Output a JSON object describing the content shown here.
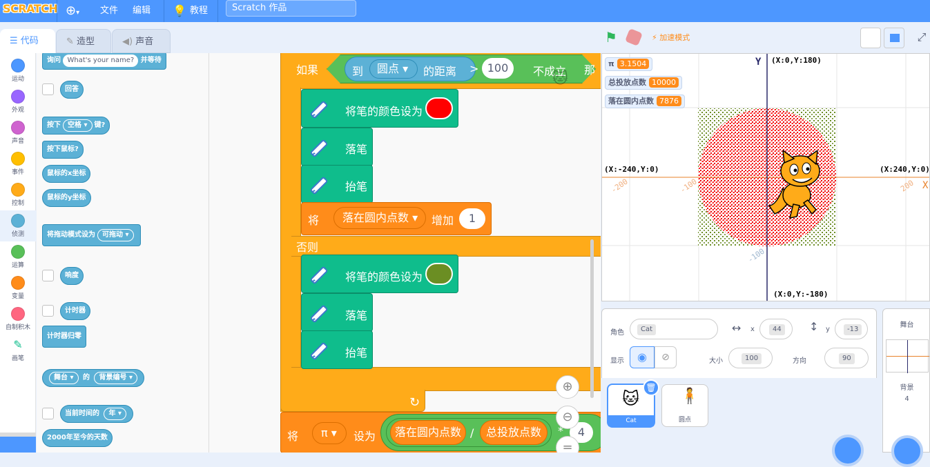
{
  "menubar": {
    "logo": "SCRATCH",
    "file": "文件",
    "edit": "编辑",
    "tutorials": "教程",
    "project_title": "Scratch 作品"
  },
  "tabs": {
    "code": "代码",
    "costumes": "造型",
    "sounds": "声音"
  },
  "categories": [
    {
      "label": "运动",
      "color": "#4c97ff"
    },
    {
      "label": "外观",
      "color": "#9966ff"
    },
    {
      "label": "声音",
      "color": "#cf63cf"
    },
    {
      "label": "事件",
      "color": "#ffbf00"
    },
    {
      "label": "控制",
      "color": "#ffab19"
    },
    {
      "label": "侦测",
      "color": "#5cb1d6"
    },
    {
      "label": "运算",
      "color": "#59c059"
    },
    {
      "label": "变量",
      "color": "#ff8c1a"
    },
    {
      "label": "自制积木",
      "color": "#ff6680"
    },
    {
      "label": "画笔",
      "color": "#0fbd8c"
    }
  ],
  "palette": {
    "ask_prefix": "询问",
    "ask_default": "What's your name?",
    "ask_suffix": "并等待",
    "answer": "回答",
    "key_pressed_prefix": "按下",
    "key_space": "空格",
    "key_pressed_suffix": "键?",
    "mouse_down": "按下鼠标?",
    "mouse_x": "鼠标的x坐标",
    "mouse_y": "鼠标的y坐标",
    "drag_mode_prefix": "将拖动模式设为",
    "drag_mode_value": "可拖动",
    "loudness": "响度",
    "timer": "计时器",
    "reset_timer": "计时器归零",
    "of_stage": "舞台",
    "of_word": "的",
    "of_backdrop": "背景编号",
    "current_prefix": "当前时间的",
    "current_year": "年",
    "days_since": "2000年至今的天数"
  },
  "script": {
    "if_label": "如果",
    "to_label": "到",
    "target": "圆点",
    "distance_label": "的距离",
    "gt": ">",
    "compare_value": "100",
    "not_true": "不成立",
    "then": "那",
    "set_pen_color": "将笔的颜色设为",
    "pen_down": "落笔",
    "pen_up": "抬笔",
    "change_prefix": "将",
    "change_var": "落在圆内点数",
    "change_word": "增加",
    "change_value": "1",
    "else_label": "否则",
    "set_prefix": "将",
    "set_var": "π",
    "set_word": "设为",
    "div_left": "落在圆内点数",
    "div_op": "/",
    "div_right": "总投放点数",
    "mul_op": "*",
    "mul_value": "4",
    "color_red": "#ff0000",
    "color_olive": "#6b8e23"
  },
  "stage_header": {
    "turbo": "加速模式"
  },
  "monitors": [
    {
      "label": "π",
      "value": "3.1504"
    },
    {
      "label": "总投放点数",
      "value": "10000"
    },
    {
      "label": "落在圆内点数",
      "value": "7876"
    }
  ],
  "axes": {
    "top": "(X:0,Y:180)",
    "bottom": "(X:0,Y:-180)",
    "left": "(X:-240,Y:0)",
    "right": "(X:240,Y:0)",
    "y_label": "Y",
    "x_label": "X",
    "tick_m200": "-200",
    "tick_m100": "-100",
    "tick_200": "200",
    "tick_ym100": "-100"
  },
  "sprite_info": {
    "sprite_label": "角色",
    "sprite_name": "Cat",
    "x_label": "x",
    "x_value": "44",
    "y_label": "y",
    "y_value": "-13",
    "show_label": "显示",
    "size_label": "大小",
    "size_value": "100",
    "direction_label": "方向",
    "direction_value": "90"
  },
  "sprites": [
    {
      "name": "Cat"
    },
    {
      "name": "圆点"
    }
  ],
  "stage_pane": {
    "title": "舞台",
    "backdrops_label": "背景",
    "backdrops_count": "4"
  }
}
